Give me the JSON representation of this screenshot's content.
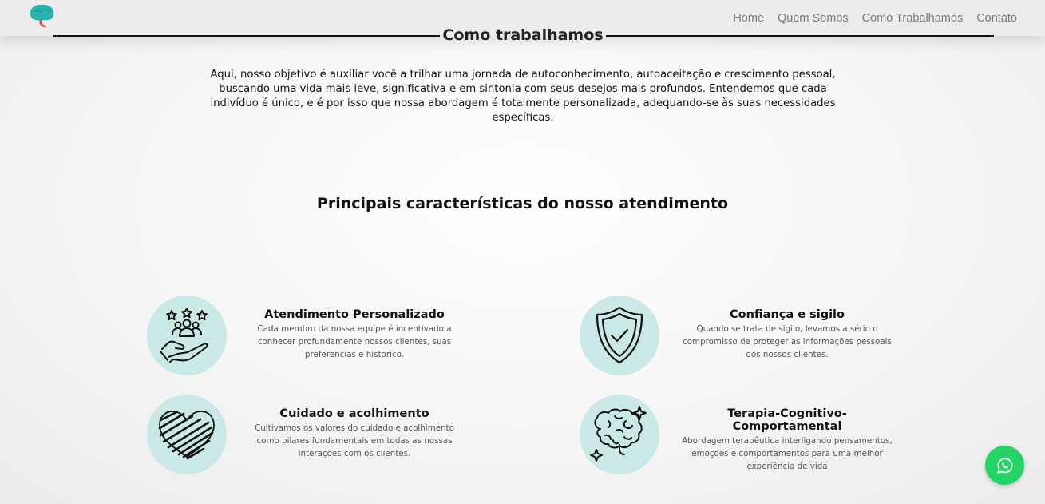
{
  "nav": {
    "links": [
      "Home",
      "Quem Somos",
      "Como Trabalhamos",
      "Contato"
    ]
  },
  "section": {
    "title": "Como trabalhamos",
    "intro": "Aqui, nosso objetivo é auxiliar você a trilhar uma jornada de autoconhecimento, autoaceitação e crescimento pessoal, buscando uma vida mais leve, significativa e em sintonia com seus desejos mais profundos. Entendemos que cada indivíduo é único, e é por isso que nossa abordagem é totalmente personalizada, adequando-se às suas necessidades específicas."
  },
  "features": {
    "heading": "Principais características do nosso atendimento",
    "items": [
      {
        "title": "Atendimento Personalizado",
        "description": "Cada membro da nossa equipe é incentivado a conhecer profundamente nossos clientes, suas preferencias e historico.",
        "icon": "hand-people-stars-icon"
      },
      {
        "title": "Confiança e sigilo",
        "description": "Quando se trata de sigilo, levamos a sério o compromisso de proteger as informações pessoais dos nossos clientes.",
        "icon": "shield-check-icon"
      },
      {
        "title": "Cuidado e acolhimento",
        "description": "Cultivamos os valores do cuidado e acolhimento como pilares fundamentais em todas as nossas interações com os clientes.",
        "icon": "heart-scribble-icon"
      },
      {
        "title": "Terapia-Cognitivo-Comportamental",
        "description": "Abordagem terapêutica interligando pensamentos, emoções e comportamentos para uma melhor experiência de vida",
        "icon": "brain-sparkles-icon"
      }
    ]
  },
  "colors": {
    "icon_circle": "#c9e8e6",
    "whatsapp": "#25d366",
    "nav_background": "#ececec",
    "logo_brain": "#2ab3ad",
    "logo_accent": "#e0443a"
  }
}
